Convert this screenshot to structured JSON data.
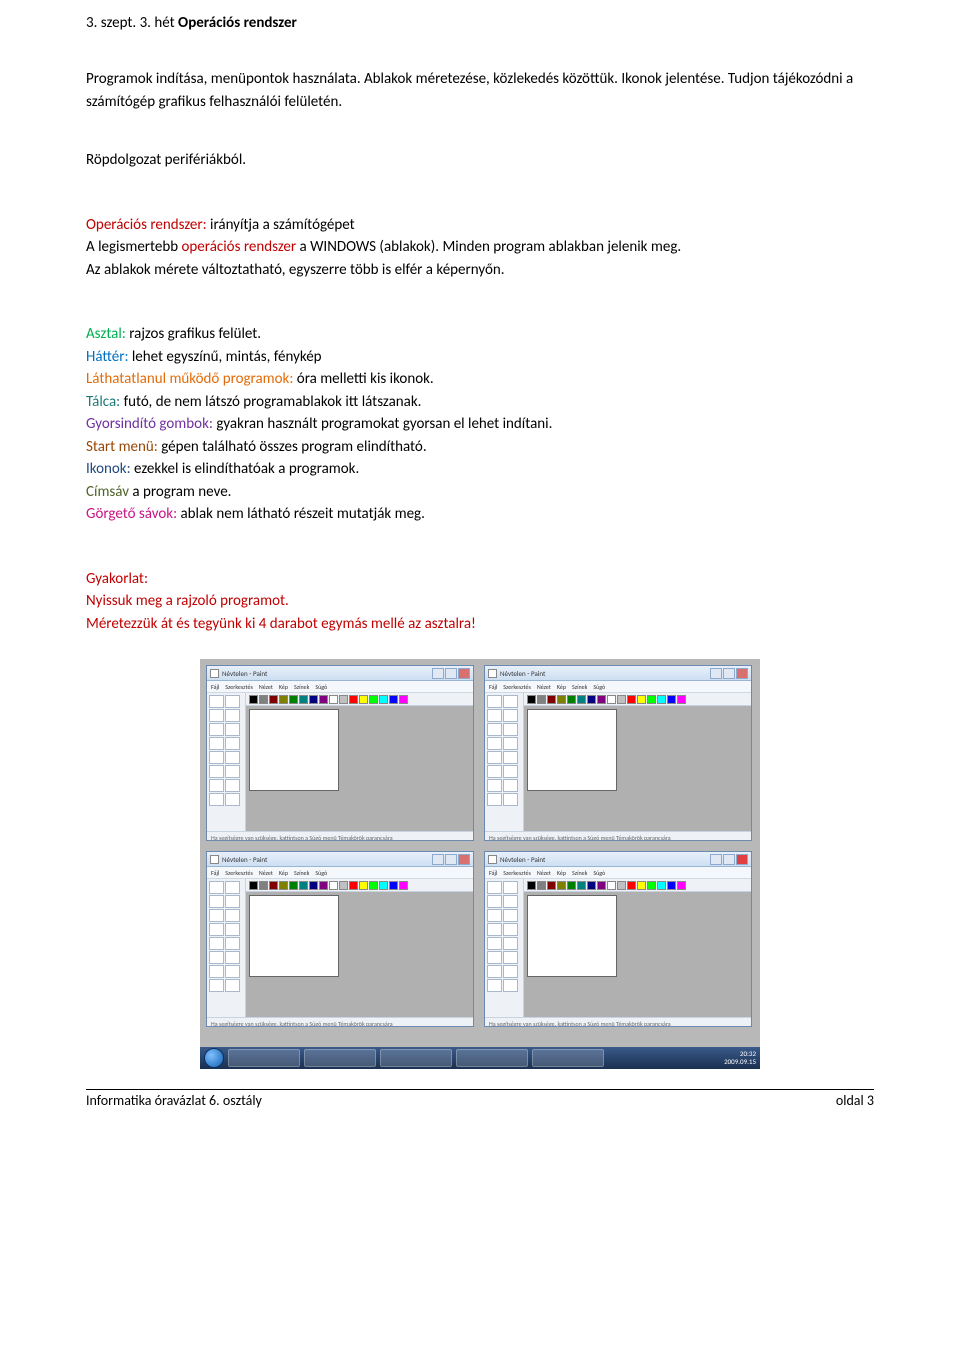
{
  "heading": {
    "prefix": "3. szept. 3. hét ",
    "title": "Operációs rendszer"
  },
  "para1": "Programok indítása, menüpontok használata. Ablakok méretezése, közlekedés közöttük. Ikonok jelentése. Tudjon tájékozódni a számítógép grafikus felhasználói felületén.",
  "para2": "Röpdolgozat perifériákból.",
  "os": {
    "l1a": "Operációs rendszer:",
    "l1b": " irányítja a számítógépet",
    "l2a": "A legismertebb ",
    "l2b": "operációs rendszer",
    "l2c": " a WINDOWS (ablakok). Minden program ablakban jelenik meg.",
    "l3": "Az ablakok mérete változtatható, egyszerre több is elfér a képernyőn."
  },
  "defs": {
    "asztal_t": "Asztal:",
    "asztal": " rajzos grafikus felület.",
    "hatter_t": "Háttér:",
    "hatter": " lehet egyszínű, mintás, fénykép",
    "lathat_t": "Láthatatlanul működő programok:",
    "lathat": " óra melletti kis ikonok.",
    "talca_t": "Tálca:",
    "talca": " futó, de nem látszó programablakok itt látszanak.",
    "gyors_t": "Gyorsindító gombok:",
    "gyors": " gyakran használt programokat gyorsan el lehet indítani.",
    "start_t": "Start menü:",
    "start": " gépen található összes program elindítható.",
    "ikonok_t": "Ikonok:",
    "ikonok": " ezekkel is elindíthatóak a programok.",
    "cimsav_t": "Címsáv",
    "cimsav": " a program neve.",
    "gorgeto_t": "Görgető sávok:",
    "gorgeto": " ablak nem látható részeit mutatják meg."
  },
  "gyak": {
    "t": "Gyakorlat:",
    "l1": "Nyissuk meg a rajzoló programot.",
    "l2": "Méretezzük át és tegyünk ki 4 darabot egymás mellé az asztalra!"
  },
  "paint": {
    "title": "Névtelen - Paint",
    "menus": [
      "Fájl",
      "Szerkesztés",
      "Nézet",
      "Kép",
      "Színek",
      "Súgó"
    ],
    "status": "Ha segítségre van szüksége, kattintson a Súgó menü Témakörök parancsára",
    "palette": [
      "#000",
      "#808080",
      "#800000",
      "#808000",
      "#008000",
      "#008080",
      "#000080",
      "#800080",
      "#ffffff",
      "#c0c0c0",
      "#ff0000",
      "#ffff00",
      "#00ff00",
      "#00ffff",
      "#0000ff",
      "#ff00ff"
    ]
  },
  "clock": {
    "time": "20:32",
    "date": "2009.09.15"
  },
  "footer": {
    "left": "Informatika óravázlat 6. osztály",
    "right": "oldal 3"
  }
}
